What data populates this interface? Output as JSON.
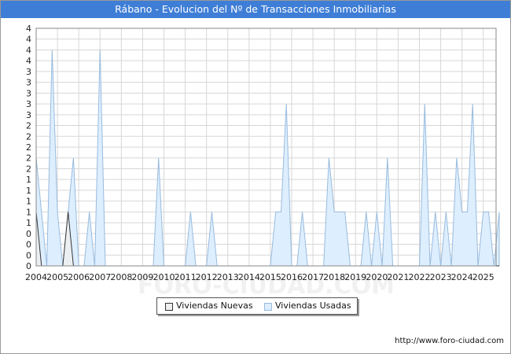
{
  "title": "Rábano - Evolucion del Nº de Transacciones Inmobiliarias",
  "footer_url": "http://www.foro-ciudad.com",
  "watermark": "FORO-CIUDAD.COM",
  "colors": {
    "title_bg": "#3f7ed6",
    "usadas_fill": "#ddeeff",
    "usadas_stroke": "#99bbdd",
    "nuevas_fill": "#eeeeee",
    "nuevas_stroke": "#333333"
  },
  "chart_data": {
    "type": "area",
    "ylim": [
      0,
      4.4
    ],
    "y_tick_labels": [
      "0",
      "0",
      "0",
      "0",
      "1",
      "1",
      "1",
      "1",
      "1",
      "2",
      "2",
      "2",
      "2",
      "2",
      "3",
      "3",
      "3",
      "3",
      "3",
      "4",
      "4",
      "4",
      "4"
    ],
    "x_tick_labels": [
      "2004",
      "2005",
      "2006",
      "2007",
      "2008",
      "2009",
      "2010",
      "2011",
      "2012",
      "2013",
      "2014",
      "2015",
      "2016",
      "2017",
      "2018",
      "2019",
      "2020",
      "2021",
      "2022",
      "2023",
      "2024",
      "2025"
    ],
    "grid": true,
    "legend_placement": "bottom-center",
    "x_start": 2004.0,
    "x_step": 0.25,
    "series": [
      {
        "name": "Viviendas Nuevas",
        "values": [
          1,
          0,
          0,
          0,
          0,
          0,
          1,
          0,
          0,
          0,
          0,
          0,
          0,
          0,
          0,
          0,
          0,
          0,
          0,
          0,
          0,
          0,
          0,
          0,
          0,
          0,
          0,
          0,
          0,
          0,
          0,
          0,
          0,
          0,
          0,
          0,
          0,
          0,
          0,
          0,
          0,
          0,
          0,
          0,
          0,
          0,
          0,
          0,
          0,
          0,
          0,
          0,
          0,
          0,
          0,
          0,
          0,
          0,
          0,
          0,
          0,
          0,
          0,
          0,
          0,
          0,
          0,
          0,
          0,
          0,
          0,
          0,
          0,
          0,
          0,
          0,
          0,
          0,
          0,
          0,
          0,
          0,
          0,
          0,
          0,
          0,
          0,
          0
        ]
      },
      {
        "name": "Viviendas Usadas",
        "values": [
          2,
          1,
          0,
          4,
          1,
          0,
          1,
          2,
          0,
          0,
          1,
          0,
          4,
          0,
          0,
          0,
          0,
          0,
          0,
          0,
          0,
          0,
          0,
          2,
          0,
          0,
          0,
          0,
          0,
          1,
          0,
          0,
          0,
          1,
          0,
          0,
          0,
          0,
          0,
          0,
          0,
          0,
          0,
          0,
          0,
          1,
          1,
          3,
          0,
          0,
          1,
          0,
          0,
          0,
          0,
          2,
          1,
          1,
          1,
          0,
          0,
          0,
          1,
          0,
          1,
          0,
          2,
          0,
          0,
          0,
          0,
          0,
          0,
          3,
          0,
          1,
          0,
          1,
          0,
          2,
          1,
          1,
          3,
          0,
          1,
          1,
          0,
          1
        ]
      }
    ]
  }
}
